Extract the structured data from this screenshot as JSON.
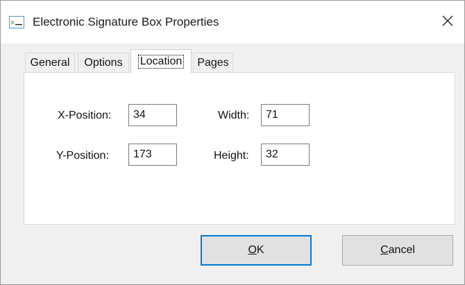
{
  "window": {
    "title": "Electronic Signature Box Properties"
  },
  "tabs": [
    {
      "label": "General",
      "active": false
    },
    {
      "label": "Options",
      "active": false
    },
    {
      "label": "Location",
      "active": true
    },
    {
      "label": "Pages",
      "active": false
    }
  ],
  "location": {
    "x_position_label": "X-Position:",
    "x_position_value": "34",
    "y_position_label": "Y-Position:",
    "y_position_value": "173",
    "width_label": "Width:",
    "width_value": "71",
    "height_label": "Height:",
    "height_value": "32"
  },
  "buttons": {
    "ok_mnemonic": "O",
    "ok_rest": "K",
    "cancel_mnemonic": "C",
    "cancel_rest": "ancel"
  },
  "icons": {
    "app": "form-field-icon",
    "close": "close-icon"
  },
  "colors": {
    "default_button_border": "#0078d7",
    "app_icon_accent": "#2a8a4a"
  }
}
